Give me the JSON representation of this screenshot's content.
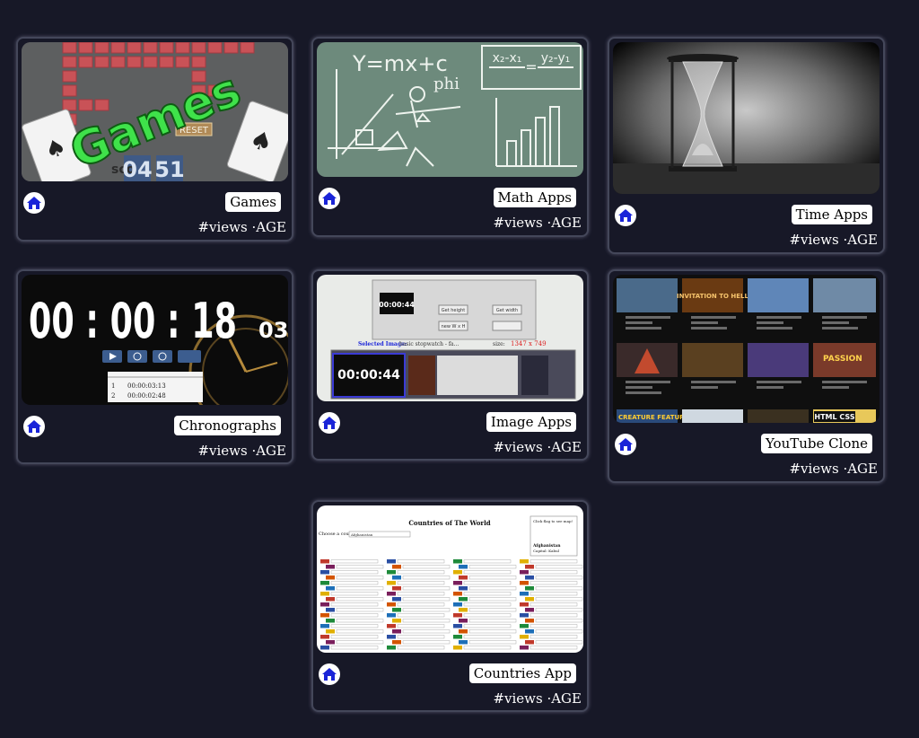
{
  "cards": [
    {
      "title": "Games",
      "meta": "#views ·AGE",
      "thumb_text": "Games",
      "score_left": "04",
      "score_right": "51",
      "reset": "RESET",
      "score_word": "sco"
    },
    {
      "title": "Math Apps",
      "meta": "#views ·AGE",
      "eq_main": "Y=mx+c",
      "eq_phi": "phi",
      "eq_slope_left": "x₂-x₁",
      "eq_slope_right": "y₂-y₁"
    },
    {
      "title": "Time Apps",
      "meta": "#views ·AGE"
    },
    {
      "title": "Chronographs",
      "meta": "#views ·AGE",
      "clock_main": "00 : 00 : 18",
      "clock_ms": "03",
      "lap1": "00:00:03:13",
      "lap2": "00:00:02:48"
    },
    {
      "title": "Image Apps",
      "meta": "#views ·AGE",
      "mini_clock": "00:00:44",
      "selected_label": "Selected Image:",
      "selected_value": "basic stopwatch - fa...",
      "size_label": "size:",
      "size_value": "1347 x 749",
      "strip_clock": "00:00:44",
      "btn_height": "Get height",
      "btn_width": "Get width",
      "btn_new": "new W x H"
    },
    {
      "title": "YouTube Clone",
      "meta": "#views ·AGE",
      "tile_invite": "INVITATION TO HELL",
      "tile_passion": "PASSION",
      "tile_html": "HTML CSS",
      "tile_creature": "CREATURE FEATURES"
    },
    {
      "title": "Countries App",
      "meta": "#views ·AGE",
      "page_title": "Countries of The World",
      "choose_label": "Choose a country:",
      "choose_value": "Afghanistan",
      "flag_hint": "Click flag to see map!",
      "capital_name": "Afghanistan",
      "capital_value": "Capital: Kabul"
    }
  ],
  "icons": {
    "home": "home-icon"
  },
  "colors": {
    "background": "#171827",
    "icon": "#1a24d8",
    "card_border": "#44475a"
  }
}
